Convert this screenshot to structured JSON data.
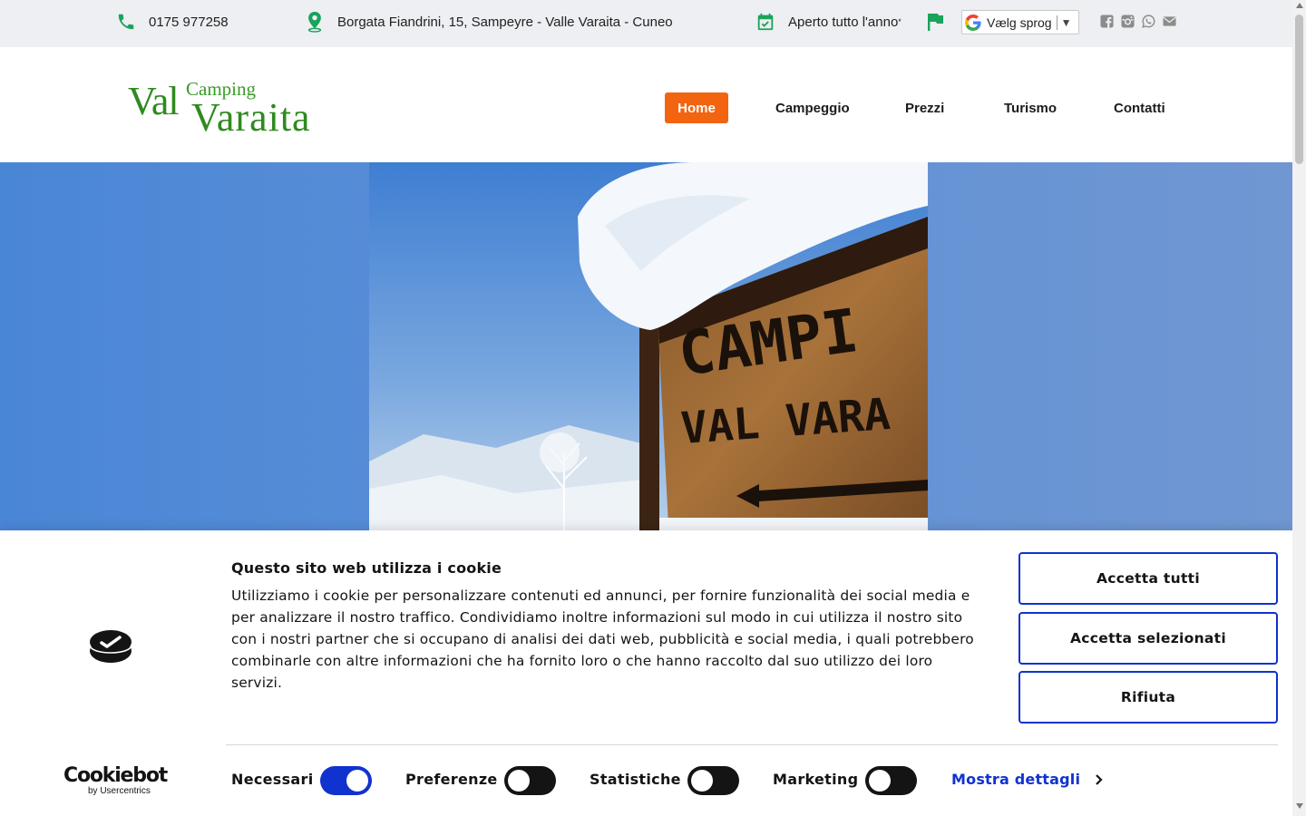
{
  "topbar": {
    "phone": "0175 977258",
    "address": "Borgata Fiandrini, 15, Sampeyre - Valle Varaita - Cuneo",
    "open_text": "Aperto tutto l'anno",
    "open_mark": "*",
    "language_select": "Vælg sprog",
    "icon_color": "#1aa35a",
    "social_icons": [
      "facebook-icon",
      "instagram-icon",
      "whatsapp-icon",
      "mail-icon"
    ]
  },
  "header": {
    "logo": {
      "word1": "Val",
      "word2": "Camping",
      "word3": "Varaita"
    },
    "nav": [
      {
        "label": "Home",
        "active": true
      },
      {
        "label": "Campeggio"
      },
      {
        "label": "Prezzi"
      },
      {
        "label": "Turismo"
      },
      {
        "label": "Contatti"
      }
    ],
    "active_color": "#f26410"
  },
  "hero": {
    "sign_line1": "CAMPI",
    "sign_line2": "VAL VARA"
  },
  "cookie": {
    "title": "Questo sito web utilizza i cookie",
    "text": "Utilizziamo i cookie per personalizzare contenuti ed annunci, per fornire funzionalità dei social media e per analizzare il nostro traffico. Condividiamo inoltre informazioni sul modo in cui utilizza il nostro sito con i nostri partner che si occupano di analisi dei dati web, pubblicità e social media, i quali potrebbero combinarle con altre informazioni che ha fornito loro o che hanno raccolto dal suo utilizzo dei loro servizi.",
    "buttons": {
      "accept_all": "Accetta tutti",
      "accept_selected": "Accetta selezionati",
      "reject": "Rifiuta"
    },
    "toggles": [
      {
        "label": "Necessari",
        "on": true
      },
      {
        "label": "Preferenze",
        "on": false
      },
      {
        "label": "Statistiche",
        "on": false
      },
      {
        "label": "Marketing",
        "on": false
      }
    ],
    "details_link": "Mostra dettagli",
    "brand": {
      "name": "Cookiebot",
      "by": "by Usercentrics"
    },
    "accent_color": "#1032cf"
  }
}
